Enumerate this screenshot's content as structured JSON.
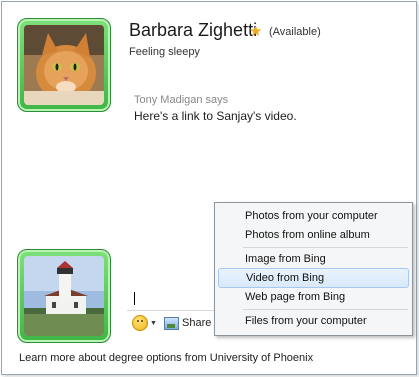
{
  "contact": {
    "name": "Barbara Zighetti",
    "status": "(Available)",
    "personal_message": "Feeling sleepy",
    "favorite_icon": "star-icon"
  },
  "conversation": {
    "sender": "Tony Madigan says",
    "message": "Here's a link to Sanjay's video."
  },
  "compose": {
    "input_value": "",
    "emoticon_icon": "smiley-icon",
    "share_label": "Share"
  },
  "share_menu": {
    "items": [
      "Photos from your computer",
      "Photos from online album",
      "Image from Bing",
      "Video from Bing",
      "Web page from Bing",
      "Files from your computer"
    ],
    "highlighted_index": 3
  },
  "footer": {
    "text": "Learn more about degree options from University of Phoenix"
  },
  "colors": {
    "avatar_frame": "#4cc254",
    "star": "#f2a91d",
    "highlight": "#d9e9fb"
  }
}
